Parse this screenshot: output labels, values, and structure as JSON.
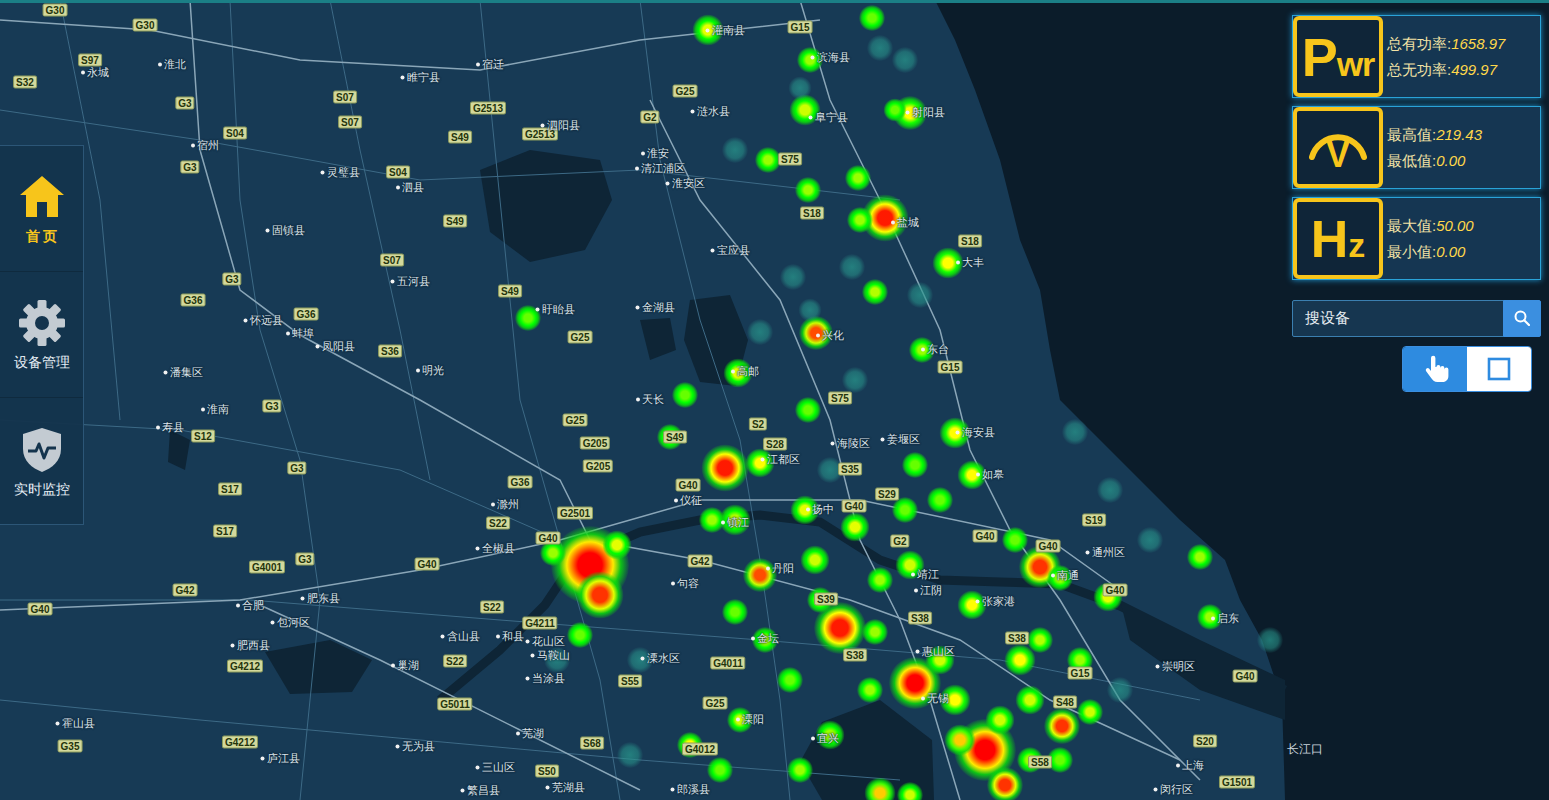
{
  "sidebar": {
    "items": [
      {
        "label": "首 页",
        "selected": true
      },
      {
        "label": "设备管理",
        "selected": false
      },
      {
        "label": "实时监控",
        "selected": false
      }
    ]
  },
  "stats": [
    {
      "icon": "Pwr",
      "rows": [
        {
          "label": "总有功率:",
          "value": "1658.97"
        },
        {
          "label": "总无功率:",
          "value": "499.97"
        }
      ]
    },
    {
      "icon": "V",
      "rows": [
        {
          "label": "最高值:",
          "value": "219.43"
        },
        {
          "label": "最低值:",
          "value": "0.00"
        }
      ]
    },
    {
      "icon": "Hz",
      "rows": [
        {
          "label": "最大值:",
          "value": "50.00"
        },
        {
          "label": "最小值:",
          "value": "0.00"
        }
      ]
    }
  ],
  "search": {
    "placeholder": "搜设备"
  },
  "map_tools": [
    {
      "selected": true
    },
    {
      "selected": false
    }
  ],
  "map": {
    "sea_label": "长江口",
    "places": [
      {
        "name": "淮北"
      },
      {
        "name": "永城"
      },
      {
        "name": "宿州"
      },
      {
        "name": "灵璧县"
      },
      {
        "name": "泗县"
      },
      {
        "name": "固镇县"
      },
      {
        "name": "五河县"
      },
      {
        "name": "怀远县"
      },
      {
        "name": "蚌埠"
      },
      {
        "name": "凤阳县"
      },
      {
        "name": "明光"
      },
      {
        "name": "潘集区"
      },
      {
        "name": "淮南"
      },
      {
        "name": "寿县"
      },
      {
        "name": "睢宁县"
      },
      {
        "name": "宿迁"
      },
      {
        "name": "泗阳县"
      },
      {
        "name": "淮安"
      },
      {
        "name": "清江浦区"
      },
      {
        "name": "淮安区"
      },
      {
        "name": "涟水县"
      },
      {
        "name": "灌南县"
      },
      {
        "name": "滨海县"
      },
      {
        "name": "阜宁县"
      },
      {
        "name": "射阳县"
      },
      {
        "name": "盐城"
      },
      {
        "name": "大丰"
      },
      {
        "name": "宝应县"
      },
      {
        "name": "金湖县"
      },
      {
        "name": "盱眙县"
      },
      {
        "name": "高邮"
      },
      {
        "name": "兴化"
      },
      {
        "name": "东台"
      },
      {
        "name": "天长"
      },
      {
        "name": "海安县"
      },
      {
        "name": "如皋"
      },
      {
        "name": "姜堰区"
      },
      {
        "name": "海陵区"
      },
      {
        "name": "江都区"
      },
      {
        "name": "仪征"
      },
      {
        "name": "扬中"
      },
      {
        "name": "镇江"
      },
      {
        "name": "滁州"
      },
      {
        "name": "全椒县"
      },
      {
        "name": "丹阳"
      },
      {
        "name": "句容"
      },
      {
        "name": "靖江"
      },
      {
        "name": "江阴"
      },
      {
        "name": "张家港"
      },
      {
        "name": "南通"
      },
      {
        "name": "通州区"
      },
      {
        "name": "启东"
      },
      {
        "name": "金坛"
      },
      {
        "name": "溧水区"
      },
      {
        "name": "惠山区"
      },
      {
        "name": "无锡"
      },
      {
        "name": "溧阳"
      },
      {
        "name": "宜兴"
      },
      {
        "name": "含山县"
      },
      {
        "name": "和县"
      },
      {
        "name": "花山区"
      },
      {
        "name": "马鞍山"
      },
      {
        "name": "当涂县"
      },
      {
        "name": "巢湖"
      },
      {
        "name": "合肥"
      },
      {
        "name": "肥东县"
      },
      {
        "name": "肥西县"
      },
      {
        "name": "包河区"
      },
      {
        "name": "霍山县"
      },
      {
        "name": "庐江县"
      },
      {
        "name": "无为县"
      },
      {
        "name": "芜湖"
      },
      {
        "name": "三山区"
      },
      {
        "name": "芜湖县"
      },
      {
        "name": "郎溪县"
      },
      {
        "name": "上海"
      },
      {
        "name": "闵行区"
      },
      {
        "name": "崇明区"
      },
      {
        "name": "繁昌县"
      }
    ],
    "roads": [
      {
        "code": "G30"
      },
      {
        "code": "G30"
      },
      {
        "code": "S97"
      },
      {
        "code": "S32"
      },
      {
        "code": "G3"
      },
      {
        "code": "S07"
      },
      {
        "code": "S07"
      },
      {
        "code": "S04"
      },
      {
        "code": "G3"
      },
      {
        "code": "S49"
      },
      {
        "code": "G2513"
      },
      {
        "code": "G2513"
      },
      {
        "code": "G2"
      },
      {
        "code": "G25"
      },
      {
        "code": "G15"
      },
      {
        "code": "S75"
      },
      {
        "code": "S18"
      },
      {
        "code": "S18"
      },
      {
        "code": "S49"
      },
      {
        "code": "S07"
      },
      {
        "code": "S04"
      },
      {
        "code": "G3"
      },
      {
        "code": "G36"
      },
      {
        "code": "G36"
      },
      {
        "code": "S36"
      },
      {
        "code": "S49"
      },
      {
        "code": "G25"
      },
      {
        "code": "G25"
      },
      {
        "code": "G205"
      },
      {
        "code": "G205"
      },
      {
        "code": "S49"
      },
      {
        "code": "S28"
      },
      {
        "code": "S35"
      },
      {
        "code": "S75"
      },
      {
        "code": "G15"
      },
      {
        "code": "S29"
      },
      {
        "code": "G40"
      },
      {
        "code": "G36"
      },
      {
        "code": "G2501"
      },
      {
        "code": "S22"
      },
      {
        "code": "G40"
      },
      {
        "code": "G42"
      },
      {
        "code": "G40"
      },
      {
        "code": "G2"
      },
      {
        "code": "G40"
      },
      {
        "code": "G40"
      },
      {
        "code": "S19"
      },
      {
        "code": "G40"
      },
      {
        "code": "G42"
      },
      {
        "code": "G4001"
      },
      {
        "code": "G3"
      },
      {
        "code": "S17"
      },
      {
        "code": "S17"
      },
      {
        "code": "G3"
      },
      {
        "code": "S12"
      },
      {
        "code": "G3"
      },
      {
        "code": "G40"
      },
      {
        "code": "G40"
      },
      {
        "code": "S22"
      },
      {
        "code": "G4211"
      },
      {
        "code": "S22"
      },
      {
        "code": "S55"
      },
      {
        "code": "G4011"
      },
      {
        "code": "S39"
      },
      {
        "code": "S38"
      },
      {
        "code": "S38"
      },
      {
        "code": "S38"
      },
      {
        "code": "G15"
      },
      {
        "code": "S48"
      },
      {
        "code": "S58"
      },
      {
        "code": "S20"
      },
      {
        "code": "G1501"
      },
      {
        "code": "G40"
      },
      {
        "code": "G4212"
      },
      {
        "code": "G5011"
      },
      {
        "code": "G25"
      },
      {
        "code": "G4012"
      },
      {
        "code": "S68"
      },
      {
        "code": "S50"
      },
      {
        "code": "G35"
      },
      {
        "code": "G4212"
      },
      {
        "code": "S2"
      }
    ],
    "heat": [
      {
        "level": 0.45
      },
      {
        "level": 0.2
      },
      {
        "level": 0.15
      },
      {
        "level": 0.15
      },
      {
        "level": 0.3
      },
      {
        "level": 0.4
      },
      {
        "level": 0.15
      },
      {
        "level": 0.5
      },
      {
        "level": 0.2
      },
      {
        "level": 0.15
      },
      {
        "level": 0.3
      },
      {
        "level": 0.3
      },
      {
        "level": 0.3
      },
      {
        "level": 0.95
      },
      {
        "level": 0.3
      },
      {
        "level": 0.5
      },
      {
        "level": 0.15
      },
      {
        "level": 0.35
      },
      {
        "level": 0.15
      },
      {
        "level": 0.15
      },
      {
        "level": 0.85
      },
      {
        "level": 0.15
      },
      {
        "level": 0.15
      },
      {
        "level": 0.3
      },
      {
        "level": 0.15
      },
      {
        "level": 0.45
      },
      {
        "level": 0.2
      },
      {
        "level": 0.2
      },
      {
        "level": 0.3
      },
      {
        "level": 0.95
      },
      {
        "level": 0.5
      },
      {
        "level": 0.5
      },
      {
        "level": 0.5
      },
      {
        "level": 0.2
      },
      {
        "level": 0.15
      },
      {
        "level": 0.15
      },
      {
        "level": 0.35
      },
      {
        "level": 0.3
      },
      {
        "level": 0.45
      },
      {
        "level": 0.45
      },
      {
        "level": 0.2
      },
      {
        "level": 0.2
      },
      {
        "level": 0.15
      },
      {
        "level": 1.0
      },
      {
        "level": 0.9
      },
      {
        "level": 0.45
      },
      {
        "level": 0.3
      },
      {
        "level": 0.85
      },
      {
        "level": 0.4
      },
      {
        "level": 0.9
      },
      {
        "level": 0.2
      },
      {
        "level": 0.3
      },
      {
        "level": 0.45
      },
      {
        "level": 0.3
      },
      {
        "level": 0.3
      },
      {
        "level": 0.15
      },
      {
        "level": 0.4
      },
      {
        "level": 0.5
      },
      {
        "level": 0.3
      },
      {
        "level": 0.95
      },
      {
        "level": 0.3
      },
      {
        "level": 0.3
      },
      {
        "level": 0.3
      },
      {
        "level": 0.2
      },
      {
        "level": 1.0
      },
      {
        "level": 0.4
      },
      {
        "level": 0.5
      },
      {
        "level": 0.35
      },
      {
        "level": 1.0
      },
      {
        "level": 0.6
      },
      {
        "level": 0.9
      },
      {
        "level": 0.4
      },
      {
        "level": 0.9
      },
      {
        "level": 0.6
      },
      {
        "level": 0.4
      },
      {
        "level": 0.5
      },
      {
        "level": 0.4
      },
      {
        "level": 0.4
      },
      {
        "level": 0.3
      },
      {
        "level": 0.3
      },
      {
        "level": 0.3
      },
      {
        "level": 0.4
      },
      {
        "level": 0.5
      },
      {
        "level": 0.2
      },
      {
        "level": 0.15
      },
      {
        "level": 0.2
      },
      {
        "level": 0.15
      },
      {
        "level": 0.3
      },
      {
        "level": 0.15
      },
      {
        "level": 0.3
      },
      {
        "level": 0.2
      },
      {
        "level": 0.2
      },
      {
        "level": 0.15
      },
      {
        "level": 0.15
      },
      {
        "level": 0.2
      }
    ]
  }
}
